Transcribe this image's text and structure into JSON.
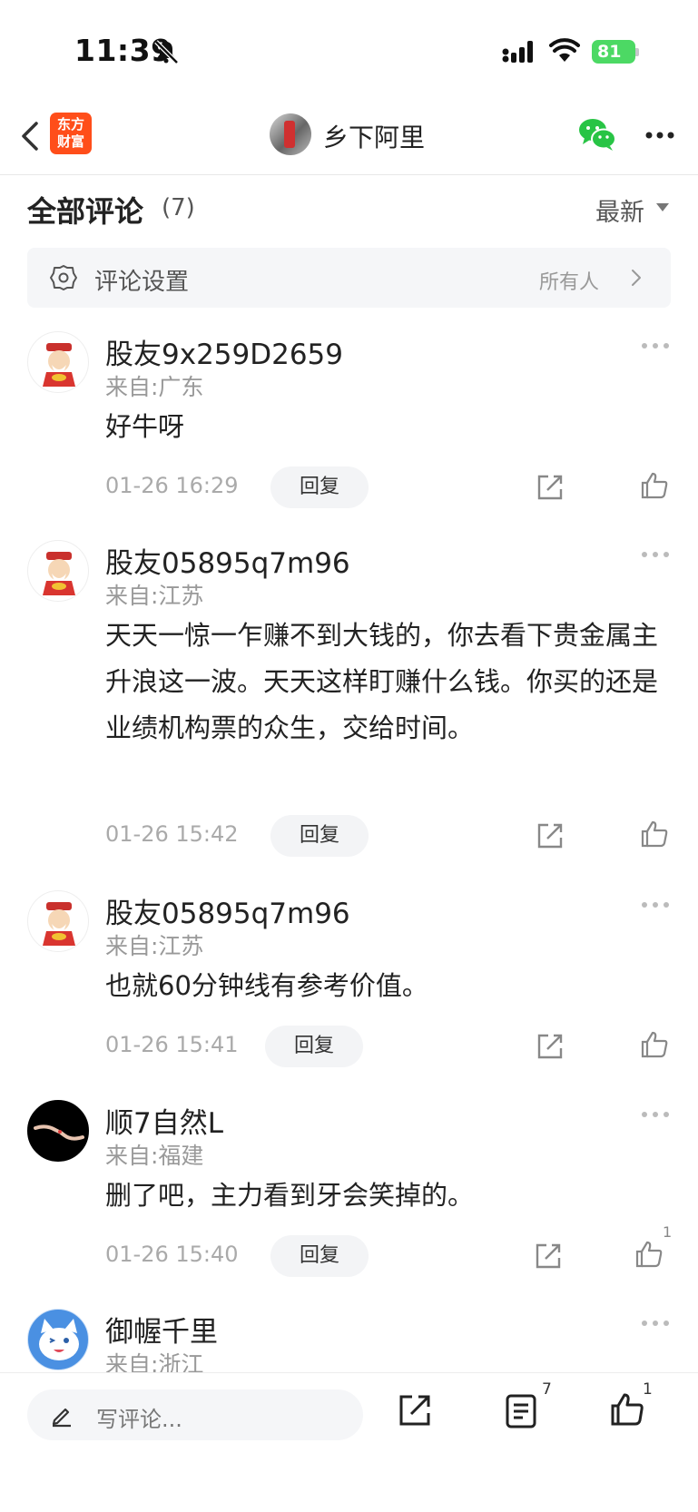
{
  "status_bar": {
    "time": "11:39",
    "battery": "81"
  },
  "nav": {
    "logo_line1": "东方",
    "logo_line2": "财富",
    "title": "乡下阿里"
  },
  "header": {
    "title": "全部评论",
    "count": "(7)",
    "sort_label": "最新"
  },
  "settings": {
    "label": "评论设置",
    "value": "所有人"
  },
  "comments": [
    {
      "name": "股友9x259D2659",
      "location": "来自:广东",
      "text": "好牛呀",
      "time": "01-26 16:29",
      "reply": "回复",
      "likes": ""
    },
    {
      "name": "股友05895q7m96",
      "location": "来自:江苏",
      "text": "天天一惊一乍赚不到大钱的，你去看下贵金属主升浪这一波。天天这样盯赚什么钱。你买的还是业绩机构票的众生，交给时间。",
      "time": "01-26 15:42",
      "reply": "回复",
      "likes": ""
    },
    {
      "name": "股友05895q7m96",
      "location": "来自:江苏",
      "text": "也就60分钟线有参考价值。",
      "time": "01-26 15:41",
      "reply": "回复",
      "likes": ""
    },
    {
      "name": "顺7自然L",
      "location": "来自:福建",
      "text": "删了吧，主力看到牙会笑掉的。",
      "time": "01-26 15:40",
      "reply": "回复",
      "likes": "1"
    },
    {
      "name": "御幄千里",
      "location": "来自:浙江"
    }
  ],
  "bottom_bar": {
    "placeholder": "写评论...",
    "comment_count": "7",
    "like_count": "1"
  }
}
